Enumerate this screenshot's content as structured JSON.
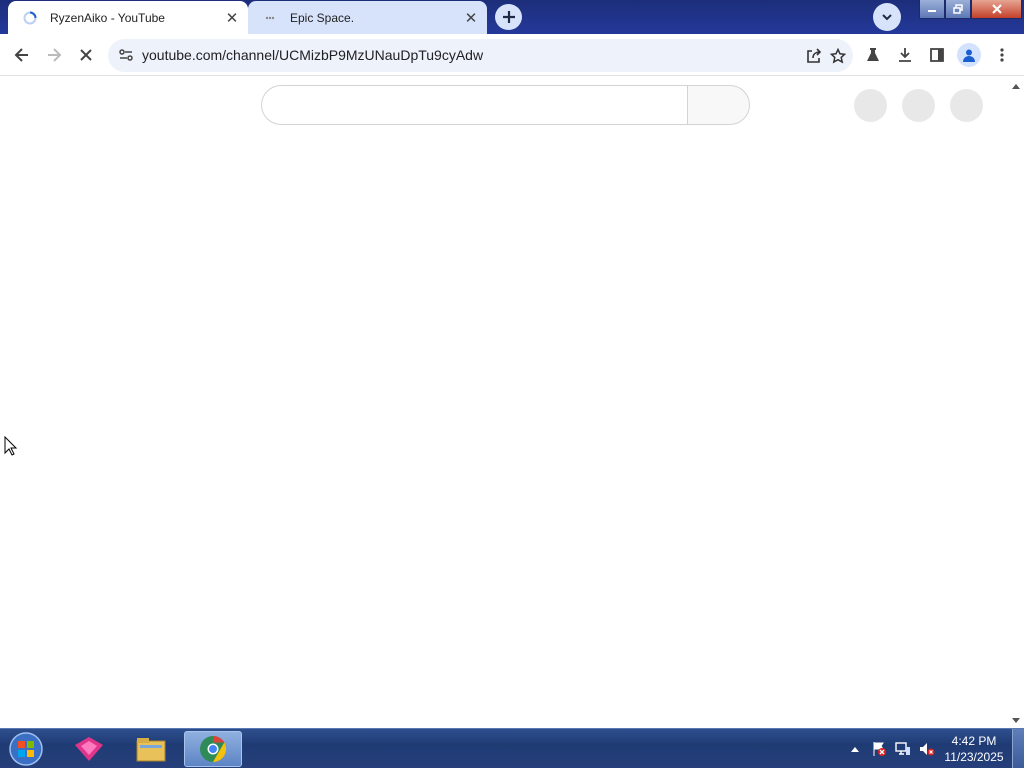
{
  "browser": {
    "tabs": [
      {
        "title": "RyzenAiko - YouTube",
        "active": true,
        "favicon": "loading-spinner-icon"
      },
      {
        "title": "Epic Space.",
        "active": false,
        "favicon": "loading-dots-icon"
      }
    ],
    "url": "youtube.com/channel/UCMizbP9MzUNauDpTu9cyAdw",
    "status": "loading",
    "colors": {
      "frame": "#1c2e7a",
      "inactive_tab": "#d7e3fb",
      "omnibox": "#eef2fb"
    }
  },
  "taskbar": {
    "time": "4:42 PM",
    "date": "11/23/2025",
    "items": [
      "start-orb-icon",
      "pinkfox-app-icon",
      "file-explorer-icon",
      "chrome-icon"
    ]
  }
}
